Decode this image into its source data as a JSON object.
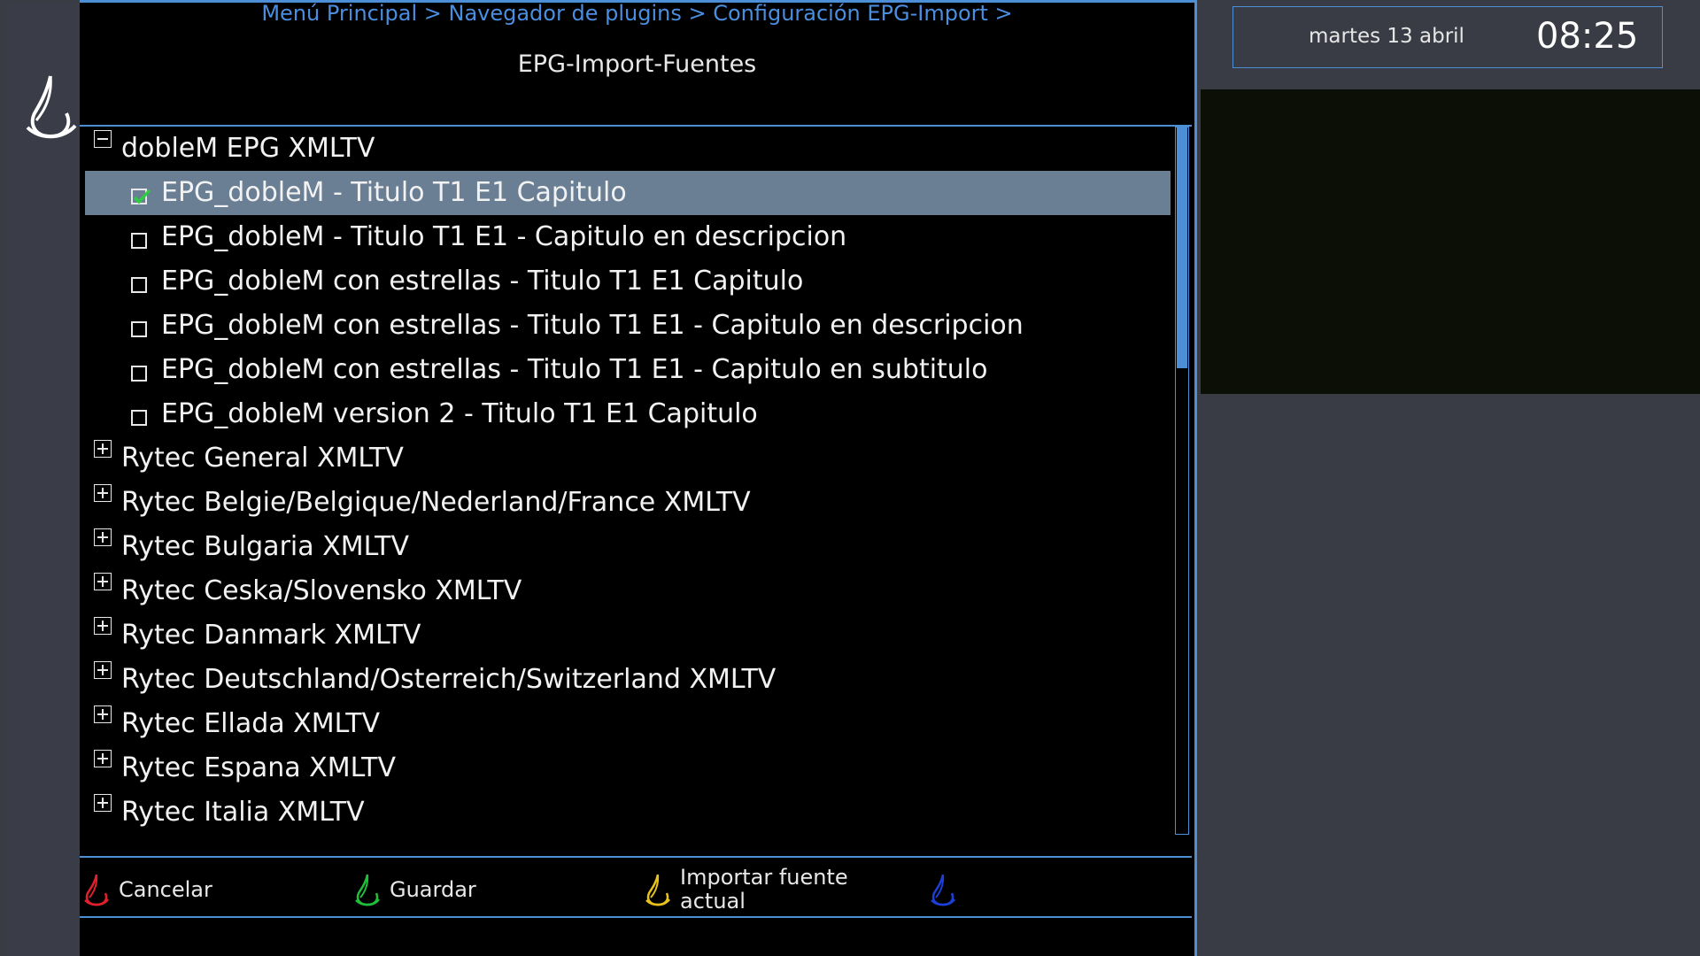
{
  "header": {
    "breadcrumb": "Menú Principal > Navegador de plugins > Configuración EPG-Import >",
    "title": "EPG-Import-Fuentes"
  },
  "clock": {
    "date": "martes 13 abril",
    "time": "08:25"
  },
  "list": {
    "rows": [
      {
        "type": "group",
        "expanded": true,
        "label": "dobleM EPG XMLTV"
      },
      {
        "type": "item",
        "checked": true,
        "selected": true,
        "label": "EPG_dobleM - Titulo T1 E1 Capitulo"
      },
      {
        "type": "item",
        "checked": false,
        "label": "EPG_dobleM - Titulo T1 E1 - Capitulo en descripcion"
      },
      {
        "type": "item",
        "checked": false,
        "label": "EPG_dobleM con estrellas - Titulo T1 E1 Capitulo"
      },
      {
        "type": "item",
        "checked": false,
        "label": "EPG_dobleM con estrellas - Titulo T1 E1 - Capitulo en descripcion"
      },
      {
        "type": "item",
        "checked": false,
        "label": "EPG_dobleM con estrellas - Titulo T1 E1 - Capitulo en subtitulo"
      },
      {
        "type": "item",
        "checked": false,
        "label": "EPG_dobleM version 2 - Titulo T1 E1 Capitulo"
      },
      {
        "type": "group",
        "expanded": false,
        "label": "Rytec General XMLTV"
      },
      {
        "type": "group",
        "expanded": false,
        "label": "Rytec Belgie/Belgique/Nederland/France XMLTV"
      },
      {
        "type": "group",
        "expanded": false,
        "label": "Rytec Bulgaria XMLTV"
      },
      {
        "type": "group",
        "expanded": false,
        "label": "Rytec Ceska/Slovensko XMLTV"
      },
      {
        "type": "group",
        "expanded": false,
        "label": "Rytec Danmark XMLTV"
      },
      {
        "type": "group",
        "expanded": false,
        "label": "Rytec Deutschland/Osterreich/Switzerland XMLTV"
      },
      {
        "type": "group",
        "expanded": false,
        "label": "Rytec Ellada XMLTV"
      },
      {
        "type": "group",
        "expanded": false,
        "label": "Rytec Espana XMLTV"
      },
      {
        "type": "group",
        "expanded": false,
        "label": "Rytec Italia XMLTV"
      }
    ]
  },
  "scrollbar": {
    "position_fraction": 0.0,
    "visible_fraction": 0.34
  },
  "keys": {
    "red": {
      "label": "Cancelar",
      "color": "#e0202a",
      "icon": "red-key-icon"
    },
    "green": {
      "label": "Guardar",
      "color": "#1fbf3a",
      "icon": "green-key-icon"
    },
    "yellow": {
      "label_line1": "Importar fuente",
      "label_line2": "actual",
      "color": "#e8c21a",
      "icon": "yellow-key-icon"
    },
    "blue": {
      "label": "",
      "color": "#1c3fd8",
      "icon": "blue-key-icon"
    }
  },
  "colors": {
    "accent": "#4d8fd6",
    "selection": "#6a7f94",
    "checkmark": "#2ecc40"
  }
}
